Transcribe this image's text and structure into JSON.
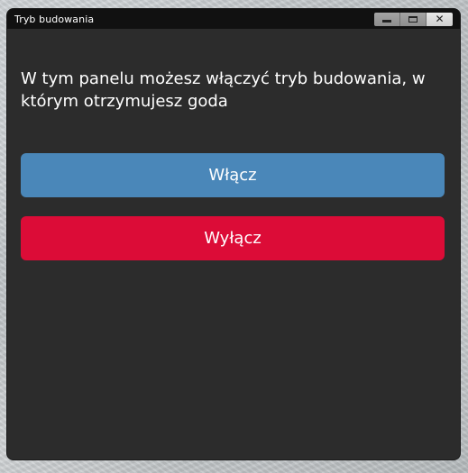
{
  "window": {
    "title": "Tryb budowania",
    "controls": {
      "minimize_icon": "minimize-icon",
      "maximize_icon": "maximize-icon",
      "close_icon": "close-icon",
      "close_glyph": "✕"
    }
  },
  "panel": {
    "description": "W tym panelu możesz włączyć tryb budowania, w którym otrzymujesz goda"
  },
  "buttons": {
    "enable_label": "Włącz",
    "disable_label": "Wyłącz"
  },
  "colors": {
    "window_bg": "#2c2c2c",
    "titlebar_bg": "#111111",
    "enable_button": "#4a87b9",
    "disable_button": "#dc0c37"
  }
}
